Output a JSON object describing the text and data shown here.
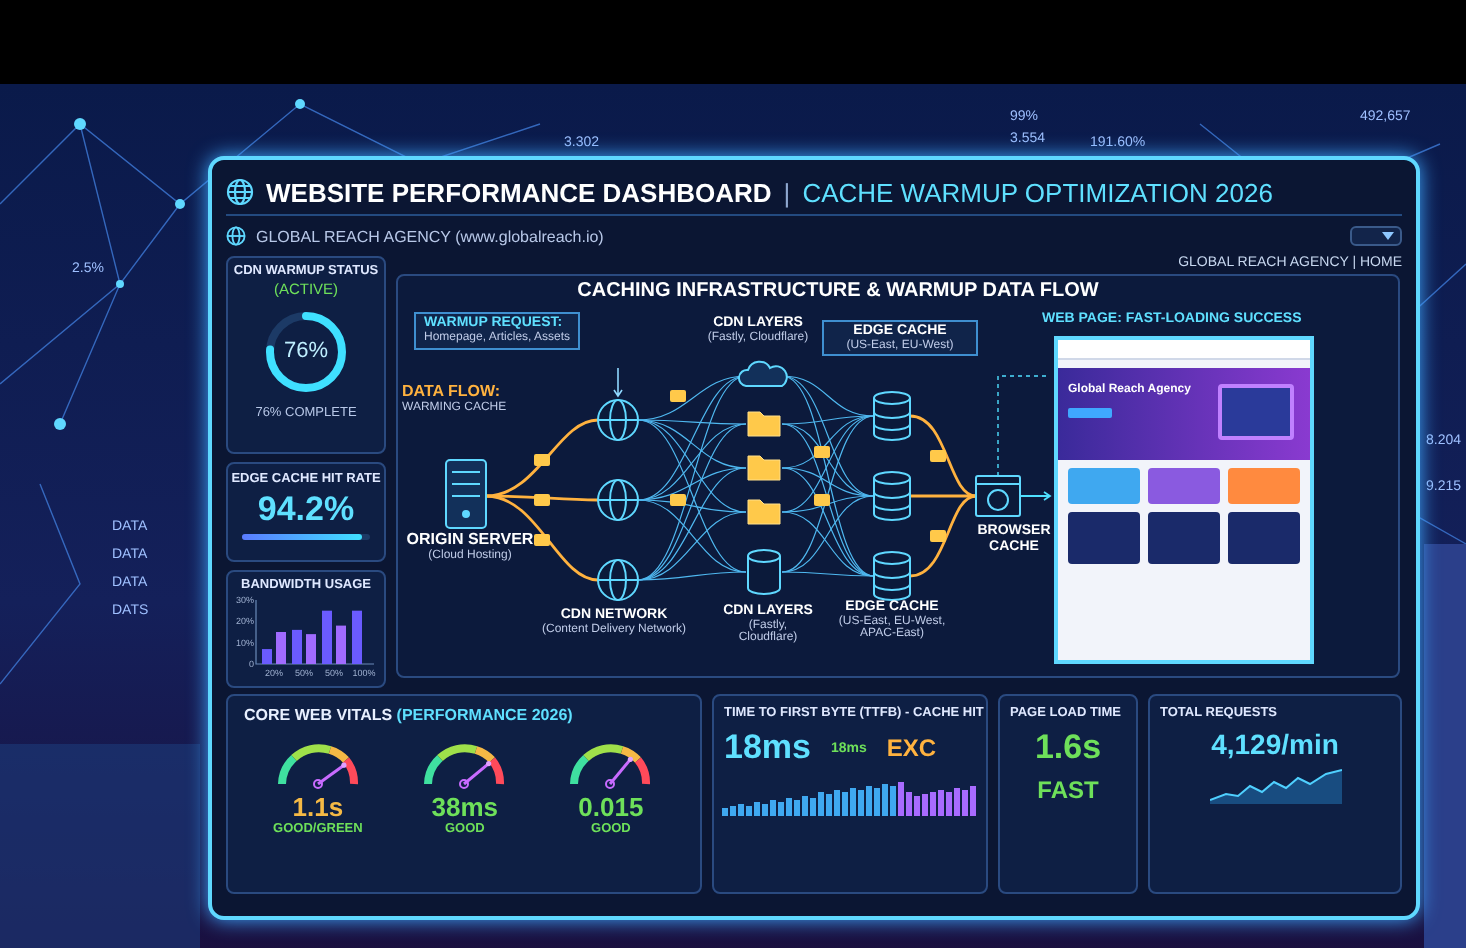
{
  "background_labels": [
    {
      "text": "3.302"
    },
    {
      "text": "2.5%"
    },
    {
      "text": "99%"
    },
    {
      "text": "3.554"
    },
    {
      "text": "191.60%"
    },
    {
      "text": "492,657"
    },
    {
      "text": "8.204"
    },
    {
      "text": "9.215"
    },
    {
      "text": "DATA"
    },
    {
      "text": "DATA"
    },
    {
      "text": "DATA"
    },
    {
      "text": "DATS"
    }
  ],
  "header": {
    "title": "WEBSITE PERFORMANCE DASHBOARD",
    "separator": "|",
    "subtitle": "CACHE WARMUP OPTIMIZATION 2026"
  },
  "agency": "GLOBAL REACH AGENCY (www.globalreach.io)",
  "nav_link": "GLOBAL REACH AGENCY | HOME",
  "warmup_status": {
    "title": "CDN WARMUP STATUS",
    "state": "(ACTIVE)",
    "level": 0.76,
    "value": "76%",
    "caption": "76% COMPLETE"
  },
  "hit_rate": {
    "title": "EDGE CACHE HIT RATE",
    "value": "94.2%",
    "level": 0.94
  },
  "bandwidth": {
    "title": "BANDWIDTH USAGE",
    "chart_data": {
      "type": "bar",
      "categories": [
        "20%",
        "50%",
        "50%",
        "100%"
      ],
      "series": [
        {
          "color": "#6a5bff",
          "values": [
            7,
            16,
            25,
            25
          ]
        },
        {
          "color": "#a06bff",
          "values": [
            15,
            14,
            18,
            null
          ]
        }
      ],
      "ylim": [
        0,
        30
      ],
      "yticks": [
        {
          "value": 0,
          "label": "0"
        },
        {
          "value": 10,
          "label": "10%"
        },
        {
          "value": 20,
          "label": "20%"
        },
        {
          "value": 30,
          "label": "30%"
        }
      ]
    }
  },
  "flow": {
    "title": "CACHING INFRASTRUCTURE & WARMUP DATA FLOW",
    "warmup_request": {
      "title": "WARMUP REQUEST:",
      "detail": "Homepage, Articles, Assets"
    },
    "data_flow": {
      "title": "DATA FLOW:",
      "subtitle": "WARMING CACHE"
    },
    "origin": {
      "title": "ORIGIN SERVER",
      "subtitle": "(Cloud Hosting)"
    },
    "cdn_network": {
      "title": "CDN NETWORK",
      "subtitle": "(Content Delivery Network)"
    },
    "cdn_layers_top": {
      "title": "CDN LAYERS",
      "subtitle": "(Fastly, Cloudflare)"
    },
    "cdn_layers_bottom": {
      "title": "CDN LAYERS",
      "subtitle": "(Fastly, Cloudflare)"
    },
    "edge_cache_top": {
      "title": "EDGE CACHE",
      "subtitle": "(US-East, EU-West)"
    },
    "edge_cache_bottom": {
      "title": "EDGE CACHE",
      "subtitle": "(US-East, EU-West, APAC-East)"
    },
    "browser_cache": {
      "title": "BROWSER CACHE"
    },
    "web_page": {
      "title": "WEB PAGE: FAST-LOADING SUCCESS",
      "hero_title": "Global Reach Agency"
    }
  },
  "vitals": {
    "title": "CORE WEB VITALS",
    "note": "(PERFORMANCE 2026)",
    "gauges": [
      {
        "value": "1.1s",
        "label": "GOOD/GREEN",
        "level": 0.8,
        "color": "#f5b945"
      },
      {
        "value": "38ms",
        "label": "GOOD",
        "level": 0.78,
        "color": "#6ee05a"
      },
      {
        "value": "0.015",
        "label": "GOOD",
        "level": 0.72,
        "color": "#6ee05a"
      }
    ]
  },
  "ttfb": {
    "title": "TIME TO FIRST BYTE (TTFB) - CACHE HIT",
    "value": "18ms",
    "small_value": "18ms",
    "grade": "EXC"
  },
  "page_load": {
    "title": "PAGE LOAD TIME",
    "value": "1.6s",
    "grade": "FAST"
  },
  "requests": {
    "title": "TOTAL REQUESTS",
    "value": "4,129/min"
  }
}
